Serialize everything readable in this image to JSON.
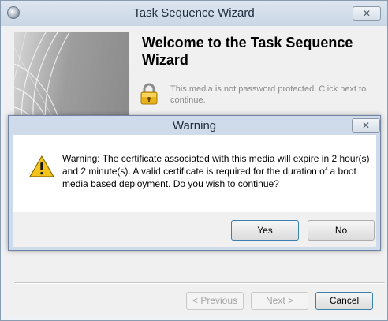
{
  "wizard": {
    "title": "Task Sequence Wizard",
    "close_label": "✕",
    "heading": "Welcome to the Task Sequence Wizard",
    "lock_message": "This media is not password protected.  Click next to continue.",
    "buttons": {
      "previous": "< Previous",
      "next": "Next >",
      "cancel": "Cancel"
    }
  },
  "dialog": {
    "title": "Warning",
    "close_label": "✕",
    "message": "Warning: The certificate associated with this media will expire in 2 hour(s) and 2 minute(s). A valid certificate is required for the duration of a boot media based deployment. Do you wish to continue?",
    "buttons": {
      "yes": "Yes",
      "no": "No"
    }
  },
  "icons": {
    "app": "wizard-app-icon",
    "lock": "lock-icon",
    "warning": "warning-icon",
    "close": "close-icon"
  },
  "colors": {
    "title_bar": "#c9d6e5",
    "dialog_frame": "#cfdbea",
    "default_button_border": "#3c7fb1",
    "warning_yellow": "#f3c31b"
  }
}
